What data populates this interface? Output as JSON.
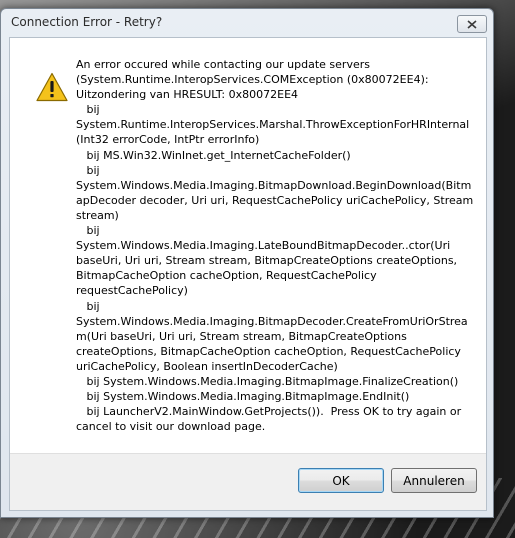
{
  "window": {
    "title": "Connection Error - Retry?"
  },
  "dialog": {
    "icon": "warning-triangle-icon",
    "message": "An error occured while contacting our update servers (System.Runtime.InteropServices.COMException (0x80072EE4): Uitzondering van HRESULT: 0x80072EE4\n   bij System.Runtime.InteropServices.Marshal.ThrowExceptionForHRInternal (Int32 errorCode, IntPtr errorInfo)\n   bij MS.Win32.WinInet.get_InternetCacheFolder()\n   bij System.Windows.Media.Imaging.BitmapDownload.BeginDownload(BitmapDecoder decoder, Uri uri, RequestCachePolicy uriCachePolicy, Stream stream)\n   bij System.Windows.Media.Imaging.LateBoundBitmapDecoder..ctor(Uri baseUri, Uri uri, Stream stream, BitmapCreateOptions createOptions, BitmapCacheOption cacheOption, RequestCachePolicy requestCachePolicy)\n   bij System.Windows.Media.Imaging.BitmapDecoder.CreateFromUriOrStream(Uri baseUri, Uri uri, Stream stream, BitmapCreateOptions createOptions, BitmapCacheOption cacheOption, RequestCachePolicy uriCachePolicy, Boolean insertInDecoderCache)\n   bij System.Windows.Media.Imaging.BitmapImage.FinalizeCreation()\n   bij System.Windows.Media.Imaging.BitmapImage.EndInit()\n   bij LauncherV2.MainWindow.GetProjects()).  Press OK to try again or cancel to visit our download page."
  },
  "buttons": {
    "ok_label": "OK",
    "cancel_label": "Annuleren"
  },
  "colors": {
    "warning_fill": "#f4c21b",
    "warning_border": "#8a6a00",
    "default_button_border": "#3c7fb1"
  }
}
